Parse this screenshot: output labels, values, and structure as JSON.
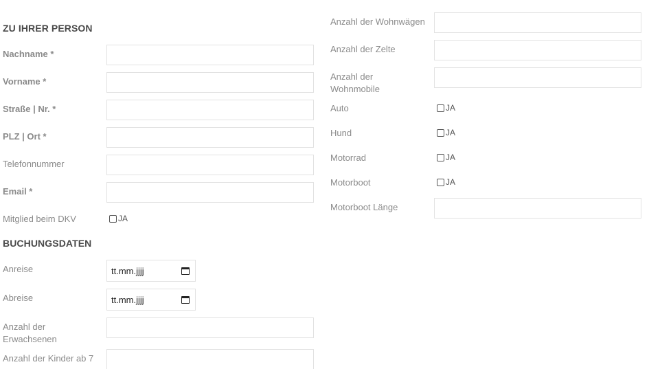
{
  "left": {
    "heading_person": "ZU IHRER PERSON",
    "nachname_label": "Nachname *",
    "vorname_label": "Vorname *",
    "strasse_label": "Straße | Nr. *",
    "plz_label": "PLZ | Ort *",
    "telefon_label": "Telefonnummer",
    "email_label": "Email *",
    "mitglied_label": "Mitglied beim DKV",
    "mitglied_check": "JA",
    "heading_buchung": "BUCHUNGSDATEN",
    "anreise_label": "Anreise",
    "anreise_value": "tt.mm.jjjj",
    "abreise_label": "Abreise",
    "abreise_value": "tt.mm.jjjj",
    "erwachsene_label_1": "Anzahl der",
    "erwachsene_label_2": "Erwachsenen",
    "kinder_label": "Anzahl der Kinder ab 7"
  },
  "right": {
    "wohnwaegen_label": "Anzahl der Wohnwägen",
    "zelte_label": "Anzahl der Zelte",
    "wohnmobile_label_1": "Anzahl der",
    "wohnmobile_label_2": "Wohnmobile",
    "auto_label": "Auto",
    "auto_check": "JA",
    "hund_label": "Hund",
    "hund_check": "JA",
    "motorrad_label": "Motorrad",
    "motorrad_check": "JA",
    "motorboot_label": "Motorboot",
    "motorboot_check": "JA",
    "motorboot_laenge_label": "Motorboot Länge"
  }
}
